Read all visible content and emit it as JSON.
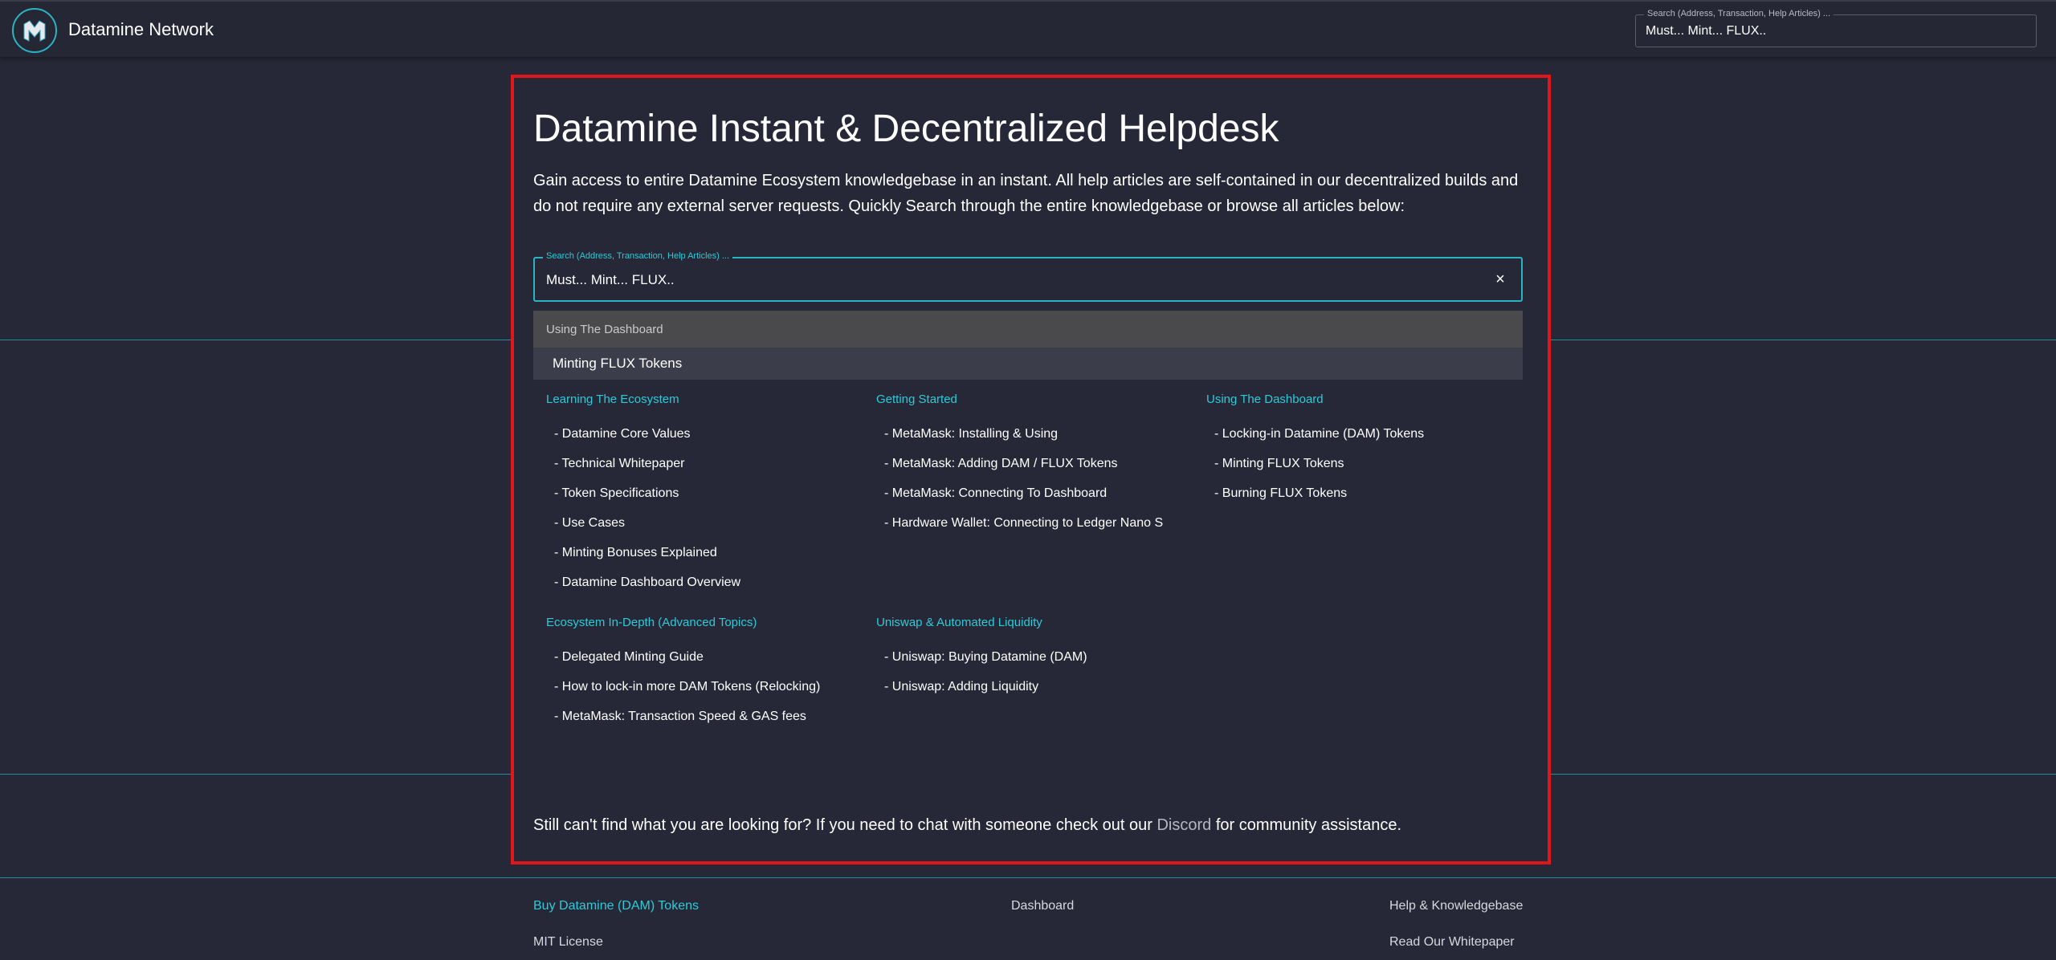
{
  "appbar": {
    "brand": "Datamine Network",
    "search_legend": "Search (Address, Transaction, Help Articles) ...",
    "search_value": "Must... Mint... FLUX.."
  },
  "panel": {
    "title": "Datamine Instant & Decentralized Helpdesk",
    "intro": "Gain access to entire Datamine Ecosystem knowledgebase in an instant. All help articles are self-contained in our decentralized builds and do not require any external server requests. Quickly Search through the entire knowledgebase or browse all articles below:",
    "search_legend": "Search (Address, Transaction, Help Articles) ...",
    "search_value": "Must... Mint... FLUX..",
    "clear_icon": "×",
    "dropdown_group": "Using The Dashboard",
    "dropdown_option": "Minting FLUX Tokens",
    "categories": [
      {
        "title": "Learning The Ecosystem",
        "items": [
          "- Datamine Core Values",
          "- Technical Whitepaper",
          "- Token Specifications",
          "- Use Cases",
          "- Minting Bonuses Explained",
          "- Datamine Dashboard Overview"
        ]
      },
      {
        "title": "Getting Started",
        "items": [
          "- MetaMask: Installing & Using",
          "- MetaMask: Adding DAM / FLUX Tokens",
          "- MetaMask: Connecting To Dashboard",
          "- Hardware Wallet: Connecting to Ledger Nano S"
        ]
      },
      {
        "title": "Using The Dashboard",
        "items": [
          "- Locking-in Datamine (DAM) Tokens",
          "- Minting FLUX Tokens",
          "- Burning FLUX Tokens"
        ]
      },
      {
        "title": "Ecosystem In-Depth (Advanced Topics)",
        "items": [
          "- Delegated Minting Guide",
          "- How to lock-in more DAM Tokens (Relocking)",
          "- MetaMask: Transaction Speed & GAS fees"
        ]
      },
      {
        "title": "Uniswap & Automated Liquidity",
        "items": [
          "- Uniswap: Buying Datamine (DAM)",
          "- Uniswap: Adding Liquidity"
        ]
      }
    ],
    "help_prefix": "Still can't find what you are looking for? If you need to chat with someone check out our ",
    "help_link": "Discord",
    "help_suffix": " for community assistance."
  },
  "footer": {
    "buy": "Buy Datamine (DAM) Tokens",
    "dashboard": "Dashboard",
    "help": "Help & Knowledgebase",
    "license": "MIT License",
    "whitepaper": "Read Our Whitepaper"
  },
  "colors": {
    "background": "#262837",
    "accent": "#2ecad8",
    "highlight_border": "#e0161b"
  }
}
